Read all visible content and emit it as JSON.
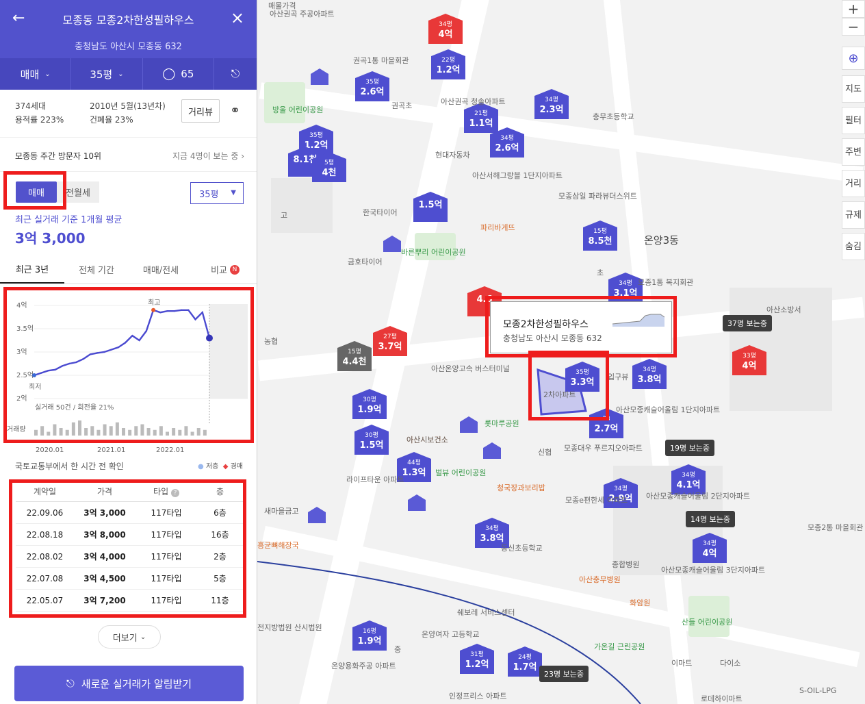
{
  "header": {
    "title": "모종동 모종2차한성필하우스",
    "address": "충청남도 아산시 모종동 632",
    "trade_type": "매매",
    "size": "35평",
    "comments": "65"
  },
  "info": {
    "households": "374세대",
    "far": "용적률 223%",
    "approval": "2010년 5월(13년차)",
    "bcr": "건폐율 23%",
    "road_view": "거리뷰"
  },
  "visitors": {
    "weekly": "모종동 주간 방문자 10위",
    "now": "지금 4명이 보는 중"
  },
  "filters": {
    "trade": "매매",
    "rent": "전월세",
    "size": "35평"
  },
  "summary": {
    "label": "최근 실거래 기준 1개월 평균",
    "price": "3억 3,000"
  },
  "tabs": [
    "최근 3년",
    "전체 기간",
    "매매/전세",
    "비교"
  ],
  "tab_badge": "N",
  "chart_data": {
    "type": "line",
    "ylim": [
      2,
      4
    ],
    "yticks": [
      "4억",
      "3.5억",
      "3억",
      "2.5억",
      "2억"
    ],
    "xticks": [
      "2020.01",
      "2021.01",
      "2022.01"
    ],
    "series": [
      {
        "values": [
          2.5,
          2.55,
          2.6,
          2.62,
          2.7,
          2.75,
          2.78,
          2.85,
          2.95,
          2.98,
          3.0,
          3.05,
          3.1,
          3.2,
          3.35,
          3.25,
          3.45,
          3.9,
          3.85,
          3.88,
          3.88,
          3.9,
          3.9,
          3.7,
          3.85,
          3.3
        ]
      }
    ],
    "max_label": "최고",
    "min_label": "최저",
    "summary_text": "실거래 50건 / 회전율 21%",
    "volume_label": "거래량",
    "volume": [
      3,
      5,
      2,
      6,
      4,
      3,
      7,
      8,
      4,
      5,
      3,
      6,
      5,
      7,
      4,
      3,
      5,
      6,
      4,
      3,
      5,
      2,
      4,
      3,
      5,
      2,
      4,
      3
    ]
  },
  "note": "국토교통부에서 한 시간 전 확인",
  "legend": {
    "direct": "저층",
    "auction": "경매"
  },
  "table": {
    "headers": [
      "계약일",
      "가격",
      "타입",
      "층"
    ],
    "rows": [
      [
        "22.09.06",
        "3억 3,000",
        "117타입",
        "6층"
      ],
      [
        "22.08.18",
        "3억 8,000",
        "117타입",
        "16층"
      ],
      [
        "22.08.02",
        "3억 4,000",
        "117타입",
        "2층"
      ],
      [
        "22.07.08",
        "3억 4,500",
        "117타입",
        "5층"
      ],
      [
        "22.05.07",
        "3억 7,200",
        "117타입",
        "11층"
      ]
    ]
  },
  "more": "더보기",
  "alarm": "새로운 실거래가 알림받기",
  "map": {
    "tooltip_name": "모종2차한성필하우스",
    "tooltip_addr": "충청남도 아산시 모종동 632",
    "controls": [
      "지도",
      "필터",
      "주변",
      "거리",
      "규제",
      "숨김"
    ],
    "pins": [
      {
        "py": "34평",
        "pr": "4억"
      },
      {
        "py": "22평",
        "pr": "1.2억"
      },
      {
        "py": "35평",
        "pr": "2.6억"
      },
      {
        "py": "21평",
        "pr": "1.1억"
      },
      {
        "py": "34평",
        "pr": "2.3억"
      },
      {
        "py": "34평",
        "pr": "2.6억"
      },
      {
        "py": "35평",
        "pr": "1.2억"
      },
      {
        "py": "",
        "pr": "8.1천"
      },
      {
        "py": "5평",
        "pr": "4천"
      },
      {
        "py": "",
        "pr": "1.5억"
      },
      {
        "py": "15평",
        "pr": "8.5천"
      },
      {
        "py": "34평",
        "pr": "3.1억"
      },
      {
        "py": "27평",
        "pr": "3.7억"
      },
      {
        "py": "15평",
        "pr": "4.4천"
      },
      {
        "py": "35평",
        "pr": "3.3억"
      },
      {
        "py": "34평",
        "pr": "3.8억"
      },
      {
        "py": "33평",
        "pr": "4억"
      },
      {
        "py": "30평",
        "pr": "1.9억"
      },
      {
        "py": "30평",
        "pr": "1.5억"
      },
      {
        "py": "44평",
        "pr": "1.3억"
      },
      {
        "py": "33",
        "pr": "2.7억"
      },
      {
        "py": "34평",
        "pr": "4.1억"
      },
      {
        "py": "34평",
        "pr": "2.9억"
      },
      {
        "py": "34평",
        "pr": "3.8억"
      },
      {
        "py": "34평",
        "pr": "4억"
      },
      {
        "py": "16평",
        "pr": "1.9억"
      },
      {
        "py": "31평",
        "pr": "1.2억"
      },
      {
        "py": "24평",
        "pr": "1.7억"
      },
      {
        "py": "",
        "pr": "4.6"
      }
    ],
    "viewing": [
      "37명 보는중",
      "19명 보는중",
      "14명 보는중",
      "23명 보는중"
    ],
    "labels": [
      "권곡1통 마을회관",
      "아산권곡 주공아파트",
      "방울 어린이공원",
      "권곡초",
      "아산권곡 청솔아파트",
      "현대자동차",
      "아산서해그랑블 1단지아파트",
      "모종삼일 파라뷰더스위트",
      "한국타이어",
      "파리바게뜨",
      "온양3동",
      "금호타이어",
      "바른뿌리 어린이공원",
      "아산소방서",
      "모종1통 복지회관",
      "농협",
      "아산온양고속 버스터미널",
      "아산모종캐슬어울림 1단지아파트",
      "롯마루공원",
      "아산시보건소",
      "신협",
      "모종대우 푸르지오아파트",
      "라이프타운 아파트",
      "벌뷰 어린이공원",
      "청국장과보리밥",
      "모종e편한세 아파트",
      "아산모종캐슬어울림 2단지아파트",
      "새마을금고",
      "흥균뼈해장국",
      "동신초등학교",
      "종합병원",
      "아산충무병원",
      "아산모종캐슬어울림 3단지아파트",
      "화암원",
      "모종2통 마을회관",
      "산들 어린이공원",
      "가온길 근린공원",
      "이마트",
      "다이소",
      "쉐보레 서비스센터",
      "온양여자 고등학교",
      "온양용화주공 아파트",
      "인정프리스 아파트",
      "로데하이마트",
      "S-OIL-LPG",
      "전지방법원 산시법원",
      "충무초등학교",
      "입구뷰",
      "2차아파트",
      "중",
      "고",
      "초",
      "매물가격",
      "아산시보건소"
    ]
  }
}
